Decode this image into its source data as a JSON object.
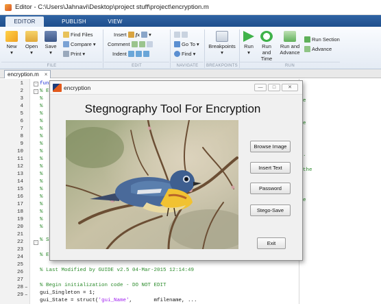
{
  "window": {
    "title": "Editor - C:\\Users\\Jahnavi\\Desktop\\project stuff\\project\\encryption.m"
  },
  "tabs": [
    "EDITOR",
    "PUBLISH",
    "VIEW"
  ],
  "ribbon": {
    "new": "New",
    "open": "Open",
    "save": "Save",
    "find_files": "Find Files",
    "compare": "Compare",
    "print": "Print",
    "insert": "Insert",
    "comment": "Comment",
    "indent": "Indent",
    "goto": "Go To",
    "find": "Find",
    "breakpoints": "Breakpoints",
    "run": "Run",
    "run_and_time": "Run and Time",
    "run_and_advance": "Run and Advance",
    "run_section": "Run Section",
    "advance": "Advance",
    "sections": [
      "FILE",
      "EDIT",
      "NAVIGATE",
      "BREAKPOINTS",
      "RUN"
    ],
    "fx": "fx"
  },
  "file_tab": {
    "name": "encryption.m",
    "close": "×"
  },
  "editor": {
    "line_numbers": [
      "1",
      "2",
      "3",
      "4",
      "5",
      "6",
      "7",
      "8",
      "9",
      "10",
      "11",
      "12",
      "13",
      "14",
      "15",
      "16",
      "17",
      "18",
      "19",
      "20",
      "21",
      "22",
      "23",
      "24",
      "25",
      "26",
      "27",
      "28",
      "29"
    ],
    "line28_marker": "–",
    "line29_marker": "–",
    "line1_fragment": "fun",
    "line2_fragment": "% E",
    "comment_mark": "%",
    "line21_fragment": "% S",
    "line23_fragment": "% E",
    "line25": "% Last Modified by GUIDE v2.5 04-Mar-2015 12:14:49",
    "line27": "% Begin initialization code - DO NOT EDIT",
    "line28": "gui_Singleton = 1;",
    "line29_a": "gui_State = struct(",
    "line29_str": "'gui_Name'",
    "line29_b": ",       mfilename, ...",
    "right_fragments": [
      "e",
      "e",
      ".",
      "the",
      "e"
    ]
  },
  "figure": {
    "title": "encryption",
    "heading": "Stegnography Tool For Encryption",
    "buttons": {
      "browse": "Browse Image",
      "insert": "Insert Text",
      "password": "Password",
      "stego_save": "Stego-Save",
      "exit": "Exit"
    },
    "window_controls": {
      "minimize": "—",
      "maximize": "□",
      "close": "✕"
    }
  },
  "colors": {
    "ribbon_tabstrip": "#2a5a99",
    "comment": "#2a8a2a",
    "string": "#a020f0"
  }
}
